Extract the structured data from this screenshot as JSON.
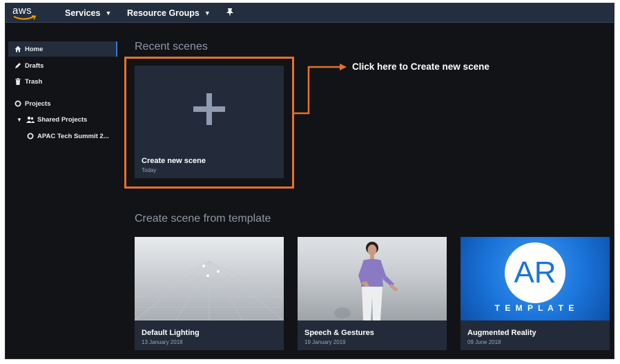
{
  "topnav": {
    "logo_text": "aws",
    "services_label": "Services",
    "resource_groups_label": "Resource Groups"
  },
  "sidebar": {
    "items": [
      {
        "label": "Home",
        "icon": "home-icon"
      },
      {
        "label": "Drafts",
        "icon": "pencil-icon"
      },
      {
        "label": "Trash",
        "icon": "trash-icon"
      },
      {
        "label": "Projects",
        "icon": "circle-icon"
      },
      {
        "label": "Shared Projects",
        "icon": "users-icon"
      },
      {
        "label": "APAC Tech Summit 2...",
        "icon": "circle-icon"
      }
    ]
  },
  "recent": {
    "title": "Recent scenes",
    "new_scene_title": "Create new scene",
    "new_scene_date": "Today"
  },
  "callout": {
    "text": "Click here to Create new scene"
  },
  "templates": {
    "title": "Create scene from template",
    "items": [
      {
        "title": "Default Lighting",
        "date": "13 January 2018"
      },
      {
        "title": "Speech & Gestures",
        "date": "19 January 2019"
      },
      {
        "title": "Augmented Reality",
        "date": "09 June 2018",
        "badge": "AR",
        "badge_sub": "T E M P L A T E"
      }
    ]
  },
  "colors": {
    "accent": "#e8702c",
    "nav_bg": "#232f3e",
    "sidebar_active": "#2f7cd3",
    "ar_blue": "#1a73d9"
  }
}
